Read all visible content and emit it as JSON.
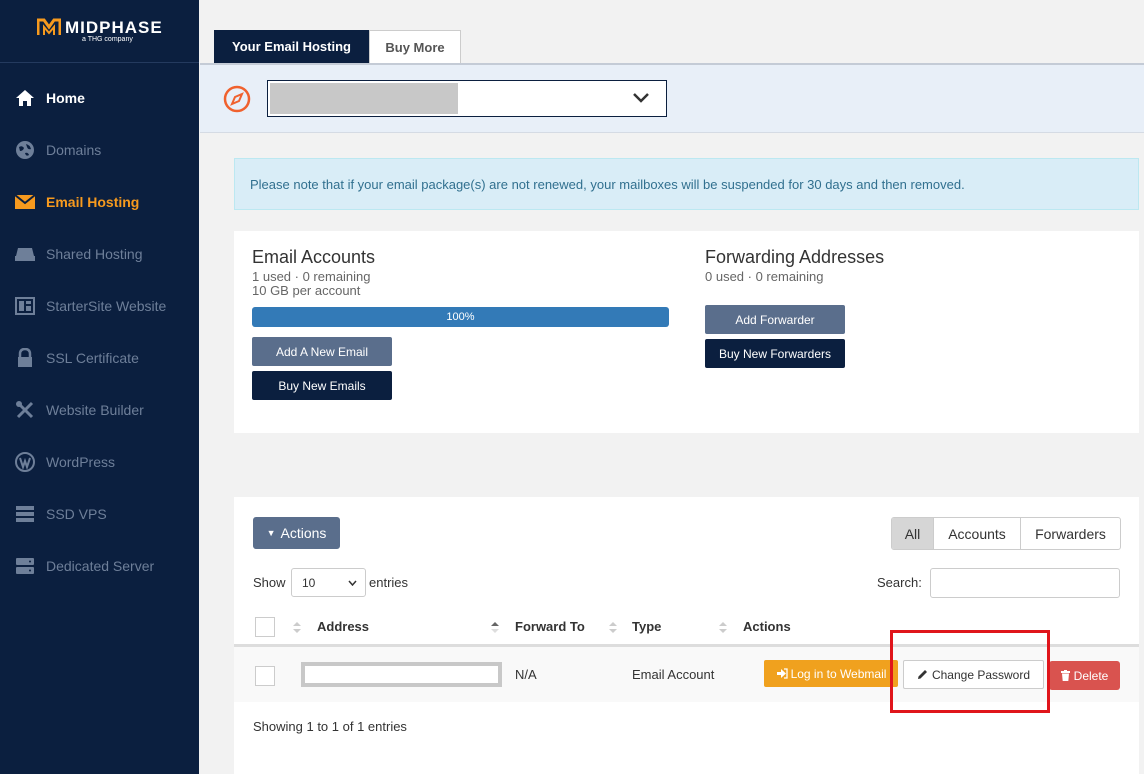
{
  "brand": {
    "name": "MIDPHASE",
    "tagline": "a THG company",
    "accent": "#f79a1e",
    "navy": "#0b1f3f"
  },
  "sidebar": {
    "items": [
      {
        "label": "Home",
        "icon": "home-icon"
      },
      {
        "label": "Domains",
        "icon": "globe-icon"
      },
      {
        "label": "Email Hosting",
        "icon": "envelope-icon"
      },
      {
        "label": "Shared Hosting",
        "icon": "server-icon"
      },
      {
        "label": "StarterSite Website",
        "icon": "layout-icon"
      },
      {
        "label": "SSL Certificate",
        "icon": "lock-icon"
      },
      {
        "label": "Website Builder",
        "icon": "tools-icon"
      },
      {
        "label": "WordPress",
        "icon": "wordpress-icon"
      },
      {
        "label": "SSD VPS",
        "icon": "vps-icon"
      },
      {
        "label": "Dedicated Server",
        "icon": "dedicated-server-icon"
      }
    ]
  },
  "tabs": {
    "active": "Your Email Hosting",
    "inactive": "Buy More"
  },
  "domain_selector": {
    "icon": "compass-icon",
    "value": ""
  },
  "alert": {
    "text": "Please note that if your email package(s) are not renewed, your mailboxes will be suspended for 30 days and then removed."
  },
  "email_accounts": {
    "title": "Email Accounts",
    "usage": "1 used · 0 remaining",
    "quota": "10 GB per account",
    "progress_label": "100%",
    "progress_value": 1.0,
    "add_button": "Add A New Email",
    "buy_button": "Buy New Emails"
  },
  "forwarding": {
    "title": "Forwarding Addresses",
    "usage": "0 used · 0 remaining",
    "add_button": "Add Forwarder",
    "buy_button": "Buy New Forwarders"
  },
  "table": {
    "actions_button": "Actions",
    "filters": [
      "All",
      "Accounts",
      "Forwarders"
    ],
    "show_label": "Show",
    "page_size": "10",
    "entries_label": "entries",
    "search_label": "Search:",
    "columns": [
      "Address",
      "Forward To",
      "Type",
      "Actions"
    ],
    "rows": [
      {
        "address": "",
        "forward_to": "N/A",
        "type": "Email Account"
      }
    ],
    "row_buttons": {
      "webmail": "Log in to Webmail",
      "change_password": "Change Password",
      "delete": "Delete"
    },
    "footer": "Showing 1 to 1 of 1 entries"
  }
}
